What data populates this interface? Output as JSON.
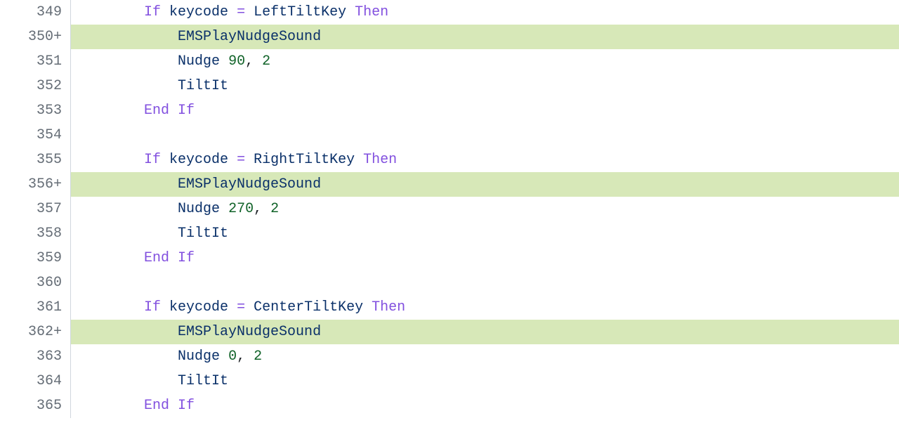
{
  "lines": [
    {
      "n": "349",
      "added": false,
      "indent": 2,
      "tokens": [
        {
          "c": "kw",
          "t": "If"
        },
        {
          "c": "plain",
          "t": " "
        },
        {
          "c": "id",
          "t": "keycode"
        },
        {
          "c": "plain",
          "t": " "
        },
        {
          "c": "kw",
          "t": "="
        },
        {
          "c": "plain",
          "t": " "
        },
        {
          "c": "id",
          "t": "LeftTiltKey"
        },
        {
          "c": "plain",
          "t": " "
        },
        {
          "c": "kw",
          "t": "Then"
        }
      ]
    },
    {
      "n": "350",
      "added": true,
      "indent": 3,
      "tokens": [
        {
          "c": "id",
          "t": "EMSPlayNudgeSound"
        }
      ]
    },
    {
      "n": "351",
      "added": false,
      "indent": 3,
      "tokens": [
        {
          "c": "id",
          "t": "Nudge"
        },
        {
          "c": "plain",
          "t": " "
        },
        {
          "c": "num",
          "t": "90"
        },
        {
          "c": "plain",
          "t": ", "
        },
        {
          "c": "num",
          "t": "2"
        }
      ]
    },
    {
      "n": "352",
      "added": false,
      "indent": 3,
      "tokens": [
        {
          "c": "id",
          "t": "TiltIt"
        }
      ]
    },
    {
      "n": "353",
      "added": false,
      "indent": 2,
      "tokens": [
        {
          "c": "kw",
          "t": "End"
        },
        {
          "c": "plain",
          "t": " "
        },
        {
          "c": "kw",
          "t": "If"
        }
      ]
    },
    {
      "n": "354",
      "added": false,
      "indent": 0,
      "tokens": []
    },
    {
      "n": "355",
      "added": false,
      "indent": 2,
      "tokens": [
        {
          "c": "kw",
          "t": "If"
        },
        {
          "c": "plain",
          "t": " "
        },
        {
          "c": "id",
          "t": "keycode"
        },
        {
          "c": "plain",
          "t": " "
        },
        {
          "c": "kw",
          "t": "="
        },
        {
          "c": "plain",
          "t": " "
        },
        {
          "c": "id",
          "t": "RightTiltKey"
        },
        {
          "c": "plain",
          "t": " "
        },
        {
          "c": "kw",
          "t": "Then"
        }
      ]
    },
    {
      "n": "356",
      "added": true,
      "indent": 3,
      "tokens": [
        {
          "c": "id",
          "t": "EMSPlayNudgeSound"
        }
      ]
    },
    {
      "n": "357",
      "added": false,
      "indent": 3,
      "tokens": [
        {
          "c": "id",
          "t": "Nudge"
        },
        {
          "c": "plain",
          "t": " "
        },
        {
          "c": "num",
          "t": "270"
        },
        {
          "c": "plain",
          "t": ", "
        },
        {
          "c": "num",
          "t": "2"
        }
      ]
    },
    {
      "n": "358",
      "added": false,
      "indent": 3,
      "tokens": [
        {
          "c": "id",
          "t": "TiltIt"
        }
      ]
    },
    {
      "n": "359",
      "added": false,
      "indent": 2,
      "tokens": [
        {
          "c": "kw",
          "t": "End"
        },
        {
          "c": "plain",
          "t": " "
        },
        {
          "c": "kw",
          "t": "If"
        }
      ]
    },
    {
      "n": "360",
      "added": false,
      "indent": 0,
      "tokens": []
    },
    {
      "n": "361",
      "added": false,
      "indent": 2,
      "tokens": [
        {
          "c": "kw",
          "t": "If"
        },
        {
          "c": "plain",
          "t": " "
        },
        {
          "c": "id",
          "t": "keycode"
        },
        {
          "c": "plain",
          "t": " "
        },
        {
          "c": "kw",
          "t": "="
        },
        {
          "c": "plain",
          "t": " "
        },
        {
          "c": "id",
          "t": "CenterTiltKey"
        },
        {
          "c": "plain",
          "t": " "
        },
        {
          "c": "kw",
          "t": "Then"
        }
      ]
    },
    {
      "n": "362",
      "added": true,
      "indent": 3,
      "tokens": [
        {
          "c": "id",
          "t": "EMSPlayNudgeSound"
        }
      ]
    },
    {
      "n": "363",
      "added": false,
      "indent": 3,
      "tokens": [
        {
          "c": "id",
          "t": "Nudge"
        },
        {
          "c": "plain",
          "t": " "
        },
        {
          "c": "num",
          "t": "0"
        },
        {
          "c": "plain",
          "t": ", "
        },
        {
          "c": "num",
          "t": "2"
        }
      ]
    },
    {
      "n": "364",
      "added": false,
      "indent": 3,
      "tokens": [
        {
          "c": "id",
          "t": "TiltIt"
        }
      ]
    },
    {
      "n": "365",
      "added": false,
      "indent": 2,
      "tokens": [
        {
          "c": "kw",
          "t": "End"
        },
        {
          "c": "plain",
          "t": " "
        },
        {
          "c": "kw",
          "t": "If"
        }
      ]
    }
  ],
  "plus_marker": "+"
}
